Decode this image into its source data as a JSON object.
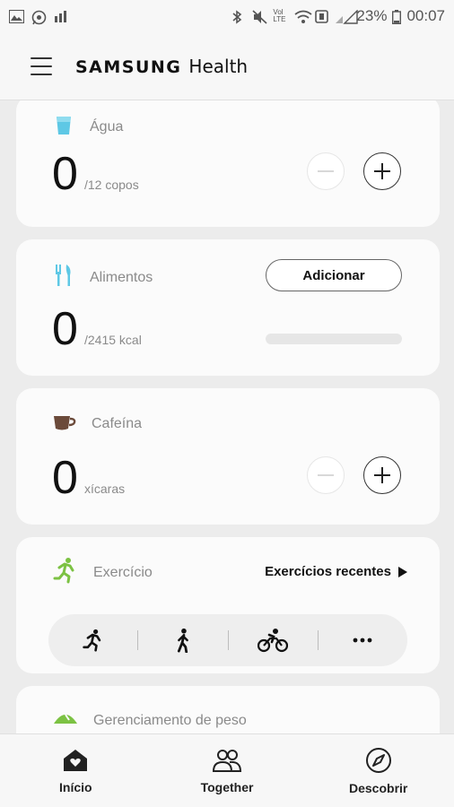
{
  "status_bar": {
    "battery": "23%",
    "time": "00:07",
    "network_label": "Vol LTE"
  },
  "header": {
    "brand_samsung": "SAMSUNG",
    "brand_health": "Health"
  },
  "cards": {
    "water": {
      "label": "Água",
      "value": "0",
      "unit": "/12 copos"
    },
    "food": {
      "label": "Alimentos",
      "value": "0",
      "unit": "/2415 kcal",
      "add_label": "Adicionar",
      "progress": 0
    },
    "caffeine": {
      "label": "Cafeína",
      "value": "0",
      "unit": "xícaras"
    },
    "exercise": {
      "label": "Exercício",
      "recent_label": "Exercícios recentes"
    },
    "weight": {
      "label": "Gerenciamento de peso"
    }
  },
  "nav": {
    "home": "Início",
    "together": "Together",
    "discover": "Descobrir"
  },
  "colors": {
    "accent_green": "#7cc243",
    "water_blue": "#5ec8e5",
    "coffee_brown": "#6b4a3a"
  }
}
